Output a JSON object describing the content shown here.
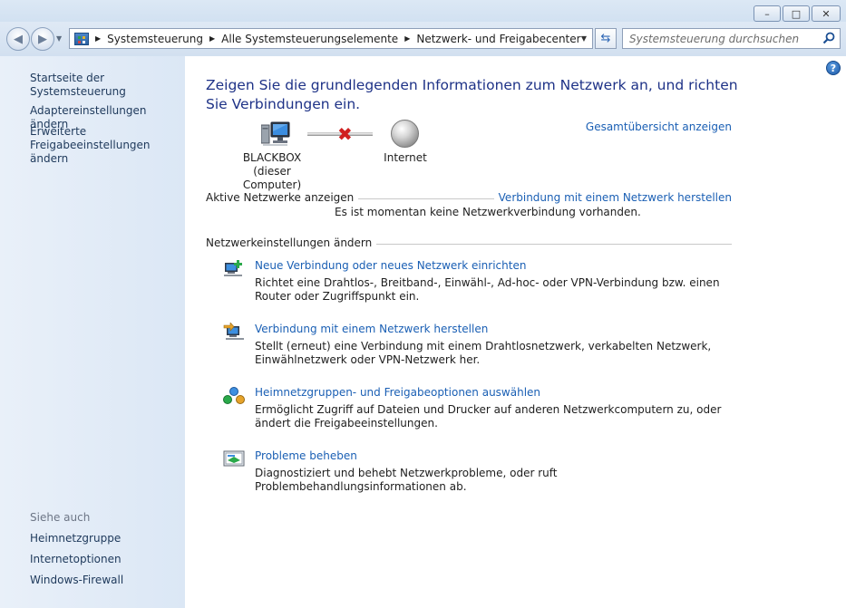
{
  "window": {
    "minimize_glyph": "–",
    "maximize_glyph": "□",
    "close_glyph": "✕"
  },
  "nav": {
    "back_glyph": "◀",
    "forward_glyph": "▶",
    "breadcrumb": [
      "Systemsteuerung",
      "Alle Systemsteuerungselemente",
      "Netzwerk- und Freigabecenter"
    ],
    "search_placeholder": "Systemsteuerung durchsuchen"
  },
  "sidebar": {
    "links": [
      "Startseite der Systemsteuerung",
      "Adaptereinstellungen ändern",
      "Erweiterte",
      "Freigabeeinstellungen ändern"
    ],
    "see_also_label": "Siehe auch",
    "see_also": [
      "Heimnetzgruppe",
      "Internetoptionen",
      "Windows-Firewall"
    ]
  },
  "main": {
    "heading": "Zeigen Sie die grundlegenden Informationen zum Netzwerk an, und richten Sie Verbindungen ein.",
    "overview_link": "Gesamtübersicht anzeigen",
    "computer_name": "BLACKBOX",
    "computer_sub": "(dieser Computer)",
    "internet_label": "Internet",
    "active_networks_label": "Aktive Netzwerke anzeigen",
    "connect_link": "Verbindung mit einem Netzwerk herstellen",
    "no_connection_text": "Es ist momentan keine Netzwerkverbindung vorhanden.",
    "settings_label": "Netzwerkeinstellungen ändern",
    "tasks": [
      {
        "icon": "new-connection-icon",
        "title": "Neue Verbindung oder neues Netzwerk einrichten",
        "desc": "Richtet eine Drahtlos-, Breitband-, Einwähl-, Ad-hoc- oder VPN-Verbindung bzw. einen Router oder Zugriffspunkt ein."
      },
      {
        "icon": "connect-network-icon",
        "title": "Verbindung mit einem Netzwerk herstellen",
        "desc": "Stellt (erneut) eine Verbindung mit einem Drahtlosnetzwerk, verkabelten Netzwerk, Einwählnetzwerk oder VPN-Netzwerk her."
      },
      {
        "icon": "homegroup-icon",
        "title": "Heimnetzgruppen- und Freigabeoptionen auswählen",
        "desc": "Ermöglicht Zugriff auf Dateien und Drucker auf anderen Netzwerkcomputern zu, oder ändert die Freigabeeinstellungen."
      },
      {
        "icon": "troubleshoot-icon",
        "title": "Probleme beheben",
        "desc": "Diagnostiziert und behebt Netzwerkprobleme, oder ruft Problembehandlungsinformationen ab."
      }
    ],
    "help_glyph": "?"
  },
  "colors": {
    "link": "#1a5fb4",
    "heading": "#1e3287",
    "sidebar_link": "#1e395b",
    "error_x": "#d02020"
  }
}
